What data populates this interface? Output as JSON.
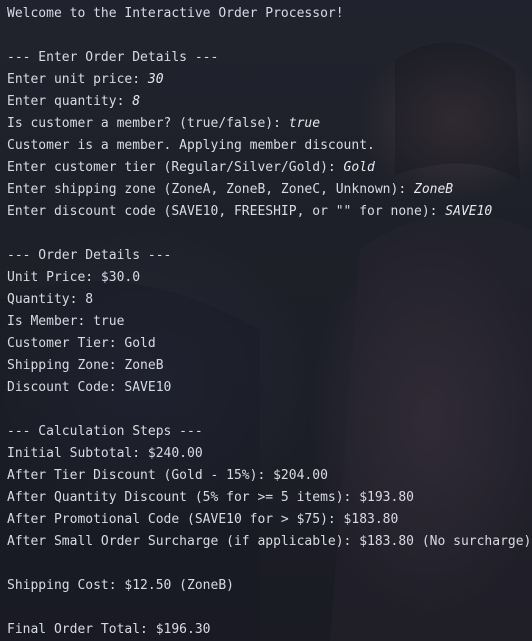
{
  "terminal": {
    "welcome": "Welcome to the Interactive Order Processor!",
    "enter_header": "--- Enter Order Details ---",
    "prompts": [
      {
        "label": "Enter unit price: ",
        "input": "30"
      },
      {
        "label": "Enter quantity: ",
        "input": "8"
      },
      {
        "label": "Is customer a member? (true/false): ",
        "input": "true"
      }
    ],
    "member_message": "Customer is a member. Applying member discount.",
    "prompts2": [
      {
        "label": "Enter customer tier (Regular/Silver/Gold): ",
        "input": "Gold"
      },
      {
        "label": "Enter shipping zone (ZoneA, ZoneB, ZoneC, Unknown): ",
        "input": "ZoneB"
      },
      {
        "label": "Enter discount code (SAVE10, FREESHIP, or \"\" for none): ",
        "input": "SAVE10"
      }
    ],
    "details_header": "--- Order Details ---",
    "details": [
      "Unit Price: $30.0",
      "Quantity: 8",
      "Is Member: true",
      "Customer Tier: Gold",
      "Shipping Zone: ZoneB",
      "Discount Code: SAVE10"
    ],
    "calc_header": "--- Calculation Steps ---",
    "steps": [
      "Initial Subtotal: $240.00",
      "After Tier Discount (Gold - 15%): $204.00",
      "After Quantity Discount (5% for >= 5 items): $193.80",
      "After Promotional Code (SAVE10 for > $75): $183.80",
      "After Small Order Surcharge (if applicable): $183.80 (No surcharge)"
    ],
    "shipping": "Shipping Cost: $12.50 (ZoneB)",
    "total": "Final Order Total: $196.30"
  },
  "colors": {
    "text": "#d8dbe3",
    "background": "#1e2029"
  }
}
